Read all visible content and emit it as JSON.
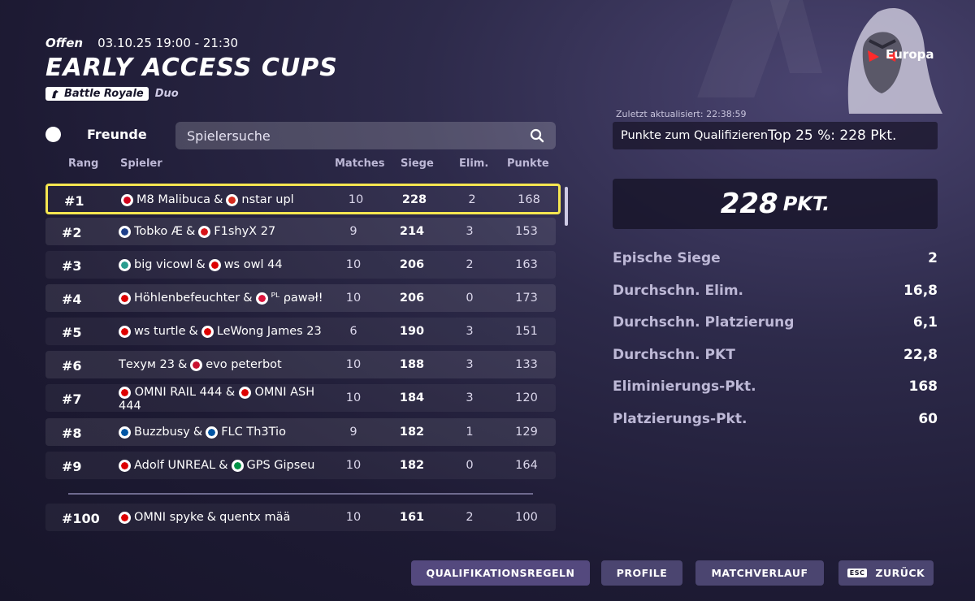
{
  "header": {
    "status": "Offen",
    "datetime": "03.10.25 19:00 - 21:30",
    "title": "EARLY ACCESS CUPS",
    "mode": "Battle Royale",
    "team": "Duo"
  },
  "friends_toggle": {
    "label": "Freunde"
  },
  "search": {
    "placeholder": "Spielersuche"
  },
  "table": {
    "columns": {
      "rank": "Rang",
      "players": "Spieler",
      "matches": "Matches",
      "wins": "Siege",
      "elims": "Elim.",
      "points": "Punkte"
    },
    "rows": [
      {
        "rank": "#1",
        "p1": "M8 Malibuca",
        "sep": "&",
        "p2": "nstar upl",
        "f1": "#d0021b",
        "f2": "#d52b1e",
        "matches": "10",
        "wins": "228",
        "elims": "2",
        "points": "168"
      },
      {
        "rank": "#2",
        "p1": "Tobko Æ",
        "sep": "&",
        "p2": "F1shyX 27",
        "f1": "#1e3f8a",
        "f2": "#d7141a",
        "matches": "9",
        "wins": "214",
        "elims": "3",
        "points": "153"
      },
      {
        "rank": "#3",
        "p1": "big vicowl",
        "sep": "&",
        "p2": "ws owl 44",
        "f1": "#2a9d8f",
        "f2": "#dd0000",
        "matches": "10",
        "wins": "206",
        "elims": "2",
        "points": "163"
      },
      {
        "rank": "#4",
        "p1": "Höhlenbefeuchter",
        "sep": "&",
        "p2": "ᴾᴸ ρawəł!",
        "f1": "#dd0000",
        "f2": "#dc143c",
        "matches": "10",
        "wins": "206",
        "elims": "0",
        "points": "173"
      },
      {
        "rank": "#5",
        "p1": "ws turtle",
        "sep": "&",
        "p2": "LeWong James 23",
        "f1": "#dd0000",
        "f2": "#dd0000",
        "matches": "6",
        "wins": "190",
        "elims": "3",
        "points": "151"
      },
      {
        "rank": "#6",
        "p1": "Техум 23",
        "sep": "&",
        "p2": "evo peterbot",
        "f1": "",
        "f2": "#c8102e",
        "matches": "10",
        "wins": "188",
        "elims": "3",
        "points": "133"
      },
      {
        "rank": "#7",
        "p1": "OMNI RAIL 444",
        "sep": "&",
        "p2": "OMNI ASH 444",
        "f1": "#dd0000",
        "f2": "#dd0000",
        "matches": "10",
        "wins": "184",
        "elims": "3",
        "points": "120"
      },
      {
        "rank": "#8",
        "p1": "Buzzbusy",
        "sep": "&",
        "p2": "FLC Th3Tio",
        "f1": "#0055a4",
        "f2": "#0055a4",
        "matches": "9",
        "wins": "182",
        "elims": "1",
        "points": "129"
      },
      {
        "rank": "#9",
        "p1": "Adolf UNREAL",
        "sep": "&",
        "p2": "GPS Gipseu",
        "f1": "#dd0000",
        "f2": "#009246",
        "matches": "10",
        "wins": "182",
        "elims": "0",
        "points": "164"
      },
      {
        "rank": "#100",
        "p1": "OMNI spyke",
        "sep": "&",
        "p2": "quentx mää",
        "f1": "#dd0000",
        "f2": "",
        "matches": "10",
        "wins": "161",
        "elims": "2",
        "points": "100"
      }
    ]
  },
  "panel": {
    "region": "Europa",
    "updated": "Zuletzt aktualisiert: 22:38:59",
    "qualify_label": "Punkte zum Qualifizieren",
    "qualify_value": "Top 25 %: 228 Pkt.",
    "big_points_number": "228",
    "big_points_unit": "PKT.",
    "stats": [
      {
        "label": "Epische Siege",
        "value": "2"
      },
      {
        "label": "Durchschn. Elim.",
        "value": "16,8"
      },
      {
        "label": "Durchschn. Platzierung",
        "value": "6,1"
      },
      {
        "label": "Durchschn. PKT",
        "value": "22,8"
      },
      {
        "label": "Eliminierungs-Pkt.",
        "value": "168"
      },
      {
        "label": "Platzierungs-Pkt.",
        "value": "60"
      }
    ]
  },
  "buttons": {
    "rules": "QUALIFIKATIONSREGELN",
    "profiles": "PROFILE",
    "history": "MATCHVERLAUF",
    "back": "ZURÜCK",
    "back_key": "ESC"
  },
  "colors": {
    "highlight": "#f5e650",
    "background": "#1d1a33"
  }
}
